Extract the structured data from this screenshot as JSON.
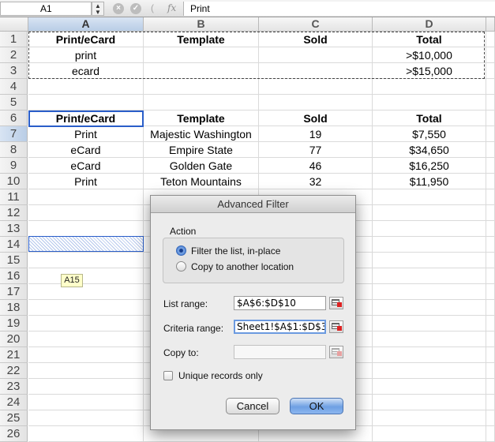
{
  "formula_bar": {
    "name_box": "A1",
    "stepper_icon": "up-down-arrows",
    "cancel_icon": "x-circle-icon",
    "enter_icon": "check-circle-icon",
    "paren_icon": "(",
    "fx_label": "fx",
    "content": "Print"
  },
  "columns": [
    "A",
    "B",
    "C",
    "D"
  ],
  "rows": [
    "1",
    "2",
    "3",
    "4",
    "5",
    "6",
    "7",
    "8",
    "9",
    "10",
    "11",
    "12",
    "13",
    "14",
    "15",
    "16",
    "17",
    "18",
    "19",
    "20",
    "21",
    "22",
    "23",
    "24",
    "25",
    "26"
  ],
  "criteria_table": {
    "headers": [
      "Print/eCard",
      "Template",
      "Sold",
      "Total"
    ],
    "rows": [
      [
        "print",
        "",
        "",
        ">$10,000"
      ],
      [
        "ecard",
        "",
        "",
        ">$15,000"
      ]
    ]
  },
  "data_table": {
    "headers": [
      "Print/eCard",
      "Template",
      "Sold",
      "Total"
    ],
    "rows": [
      [
        "Print",
        "Majestic Washington",
        "19",
        "$7,550"
      ],
      [
        "eCard",
        "Empire State",
        "77",
        "$34,650"
      ],
      [
        "eCard",
        "Golden Gate",
        "46",
        "$16,250"
      ],
      [
        "Print",
        "Teton Mountains",
        "32",
        "$11,950"
      ]
    ]
  },
  "cell_tooltip": "A15",
  "dialog": {
    "title": "Advanced Filter",
    "action_label": "Action",
    "radio_filter": "Filter the list, in-place",
    "radio_copy": "Copy to another location",
    "list_range_label": "List range:",
    "list_range_value": "$A$6:$D$10",
    "criteria_range_label": "Criteria range:",
    "criteria_range_value": "Sheet1!$A$1:$D$3",
    "copy_to_label": "Copy to:",
    "copy_to_value": "",
    "unique_label": "Unique records only",
    "cancel_label": "Cancel",
    "ok_label": "OK"
  },
  "colors": {
    "selection_blue": "#2a5ec9",
    "default_button": "#6ea0e3"
  }
}
